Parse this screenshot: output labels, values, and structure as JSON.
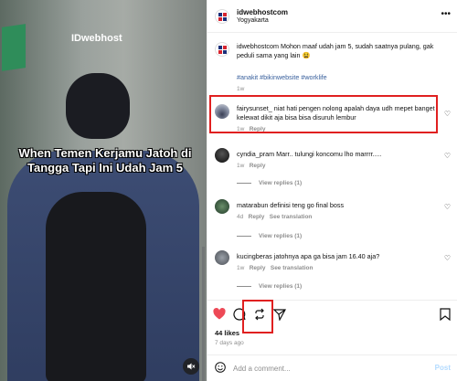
{
  "video": {
    "watermark": "IDwebhost",
    "overlay_text": "When Temen Kerjamu Jatoh di Tangga Tapi Ini Udah Jam 5",
    "mute_icon": "speaker-muted-icon"
  },
  "post": {
    "username": "idwebhostcom",
    "location": "Yogyakarta",
    "caption": {
      "username": "idwebhostcom",
      "text": "Mohon maaf udah jam 5, sudah saatnya pulang, gak peduli sama yang lain 😫",
      "hashtags": "#anakit #bikinwebsite #worklife",
      "age": "1w"
    },
    "comments": [
      {
        "username": "fairysunset_",
        "text": "niat hati pengen nolong apalah daya udh mepet banget kelewat dikit aja bisa bisa disuruh lembur",
        "age": "1w",
        "reply_label": "Reply",
        "view_replies": "",
        "translate": ""
      },
      {
        "username": "cyndia_pram",
        "text": "Marr.. tulungi koncomu lho marrrr.....",
        "age": "1w",
        "reply_label": "Reply",
        "view_replies": "View replies (1)",
        "translate": ""
      },
      {
        "username": "matarabun",
        "text": "definisi teng go final boss",
        "age": "4d",
        "reply_label": "Reply",
        "view_replies": "View replies (1)",
        "translate": "See translation"
      },
      {
        "username": "kucingberas",
        "text": "jatohnya apa ga bisa jam 16.40 aja?",
        "age": "1w",
        "reply_label": "Reply",
        "view_replies": "View replies (1)",
        "translate": "See translation"
      }
    ],
    "likes": "44 likes",
    "date": "7 days ago",
    "comment_placeholder": "Add a comment...",
    "post_label": "Post"
  },
  "colors": {
    "accent_red": "#e02020",
    "like_red": "#ed4956",
    "hashtag_blue": "#385f9c",
    "post_disabled": "#b3dbff"
  }
}
